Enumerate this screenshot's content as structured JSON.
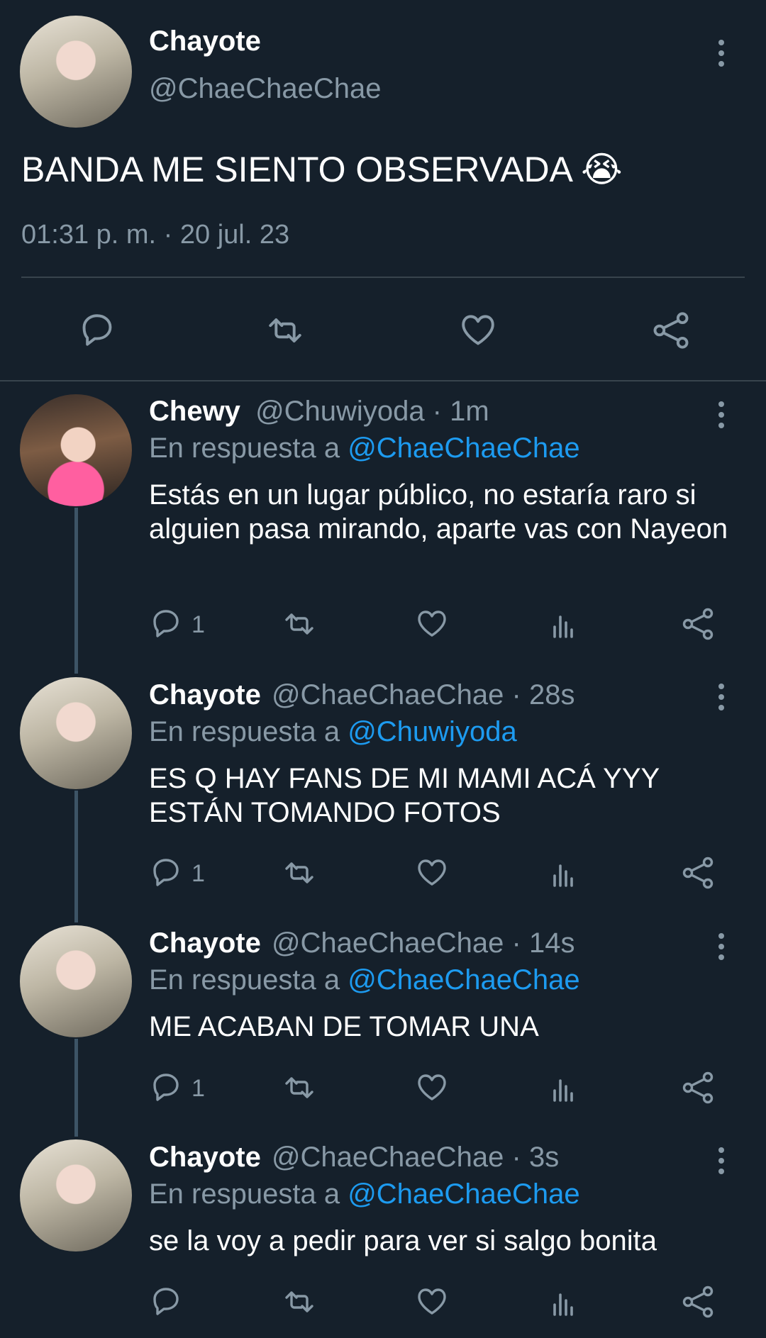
{
  "main_tweet": {
    "name": "Chayote",
    "handle": "@ChaeChaeChae",
    "text": "BANDA ME SIENTO OBSERVADA 😭",
    "timestamp": "01:31 p. m. · 20 jul. 23"
  },
  "colors": {
    "background": "#15202b",
    "muted": "#8899a6",
    "link": "#1d9bf0",
    "divider": "#38444d"
  },
  "replies": [
    {
      "name": "Chewy",
      "handle_time": "@Chuwiyoda · 1m",
      "reply_prefix": "En respuesta a",
      "reply_to": "@ChaeChaeChae",
      "text": "Estás en un lugar público, no estaría raro si alguien pasa mirando, aparte vas con Nayeon",
      "replies_count": "1"
    },
    {
      "name": "Chayote",
      "handle_time": "@ChaeChaeChae · 28s",
      "reply_prefix": "En respuesta a",
      "reply_to": "@Chuwiyoda",
      "text": "ES Q HAY FANS DE MI MAMI ACÁ YYY ESTÁN TOMANDO FOTOS",
      "replies_count": "1"
    },
    {
      "name": "Chayote",
      "handle_time": "@ChaeChaeChae · 14s",
      "reply_prefix": "En respuesta a",
      "reply_to": "@ChaeChaeChae",
      "text": "ME ACABAN DE TOMAR UNA",
      "replies_count": "1"
    },
    {
      "name": "Chayote",
      "handle_time": "@ChaeChaeChae · 3s",
      "reply_prefix": "En respuesta a",
      "reply_to": "@ChaeChaeChae",
      "text": "se la voy a pedir para ver si salgo bonita",
      "replies_count": ""
    }
  ],
  "icons": [
    "reply-icon",
    "retweet-icon",
    "like-icon",
    "share-icon",
    "analytics-icon",
    "more-options-icon"
  ]
}
